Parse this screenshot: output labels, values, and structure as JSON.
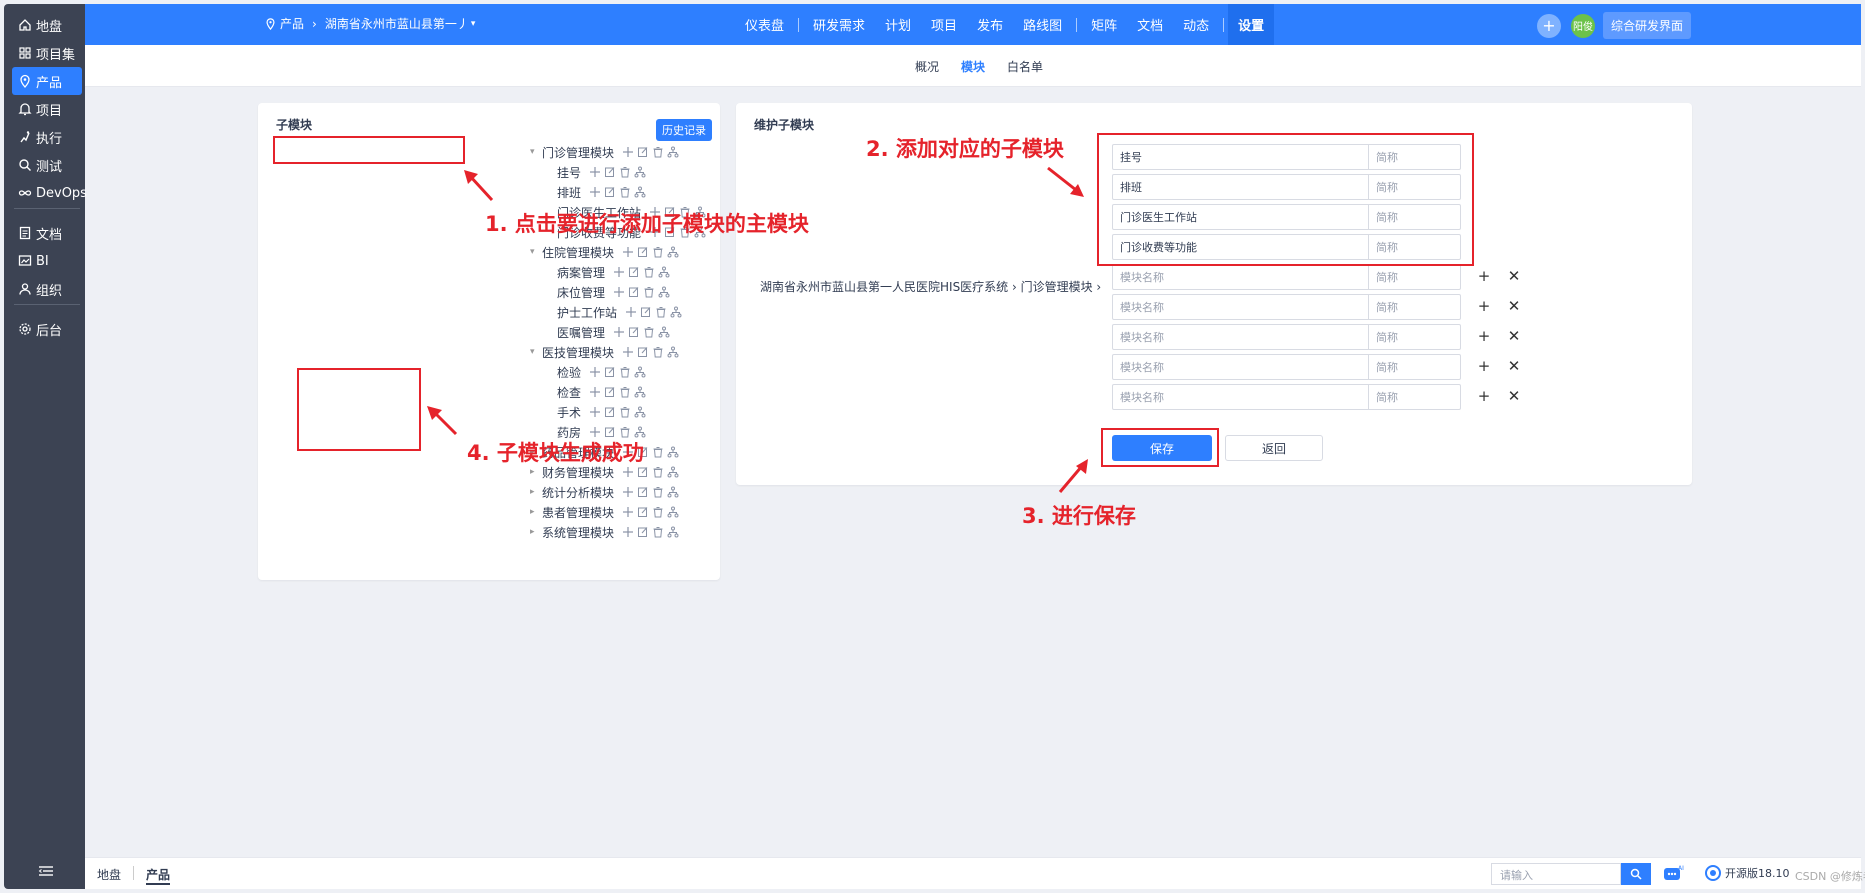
{
  "sidebar": {
    "items": [
      {
        "label": "地盘",
        "icon": "home-icon"
      },
      {
        "label": "项目集",
        "icon": "grid-icon"
      },
      {
        "label": "产品",
        "icon": "location-pin-icon"
      },
      {
        "label": "项目",
        "icon": "bell-icon"
      },
      {
        "label": "执行",
        "icon": "run-icon"
      },
      {
        "label": "测试",
        "icon": "search-icon"
      },
      {
        "label": "DevOps",
        "icon": "infinity-icon"
      },
      {
        "label": "文档",
        "icon": "doc-icon"
      },
      {
        "label": "BI",
        "icon": "chart-icon"
      },
      {
        "label": "组织",
        "icon": "user-icon"
      },
      {
        "label": "后台",
        "icon": "gear-icon"
      }
    ]
  },
  "topbar": {
    "product_label": "产品",
    "product_name": "湖南省永州市蓝山县第一丿",
    "menu": [
      "仪表盘",
      "研发需求",
      "计划",
      "项目",
      "发布",
      "路线图",
      "矩阵",
      "文档",
      "动态",
      "设置"
    ],
    "avatar_text": "阳俊",
    "mode_button": "综合研发界面"
  },
  "subnav": {
    "tabs": [
      "概况",
      "模块",
      "白名单"
    ]
  },
  "left_panel": {
    "title": "子模块",
    "history_button": "历史记录",
    "tree": [
      {
        "label": "门诊管理模块",
        "level": 0,
        "caret": "▾"
      },
      {
        "label": "挂号",
        "level": 1
      },
      {
        "label": "排班",
        "level": 1
      },
      {
        "label": "门诊医生工作站",
        "level": 1
      },
      {
        "label": "门诊收费等功能",
        "level": 1
      },
      {
        "label": "住院管理模块",
        "level": 0,
        "caret": "▾"
      },
      {
        "label": "病案管理",
        "level": 1
      },
      {
        "label": "床位管理",
        "level": 1
      },
      {
        "label": "护士工作站",
        "level": 1
      },
      {
        "label": "医嘱管理",
        "level": 1
      },
      {
        "label": "医技管理模块",
        "level": 0,
        "caret": "▾"
      },
      {
        "label": "检验",
        "level": 1
      },
      {
        "label": "检查",
        "level": 1
      },
      {
        "label": "手术",
        "level": 1
      },
      {
        "label": "药房",
        "level": 1
      },
      {
        "label": "药品管理模块",
        "level": 0,
        "caret": "▸"
      },
      {
        "label": "财务管理模块",
        "level": 0,
        "caret": "▸"
      },
      {
        "label": "统计分析模块",
        "level": 0,
        "caret": "▸"
      },
      {
        "label": "患者管理模块",
        "level": 0,
        "caret": "▸"
      },
      {
        "label": "系统管理模块",
        "level": 0,
        "caret": "▸"
      }
    ]
  },
  "right_panel": {
    "title": "维护子模块",
    "path": "湖南省永州市蓝山县第一人民医院HIS医疗系统 › 门诊管理模块 ›",
    "name_placeholder": "模块名称",
    "abbr_placeholder": "简称",
    "filled": [
      "挂号",
      "排班",
      "门诊医生工作站",
      "门诊收费等功能"
    ],
    "empty_count": 5,
    "save_button": "保存",
    "back_button": "返回"
  },
  "annotations": {
    "note1": "1. 点击要进行添加子模块的主模块",
    "note2": "2. 添加对应的子模块",
    "note3": "3. 进行保存",
    "note4": "4. 子模块生成成功"
  },
  "footer": {
    "crumbs": [
      "地盘",
      "产品"
    ],
    "search_placeholder": "请输入",
    "brand": "开源版18.10",
    "watermark": "CSDN @修炼者"
  },
  "colors": {
    "primary": "#2e7fff",
    "sidebar": "#3c4353",
    "annotation": "#e5232b"
  }
}
